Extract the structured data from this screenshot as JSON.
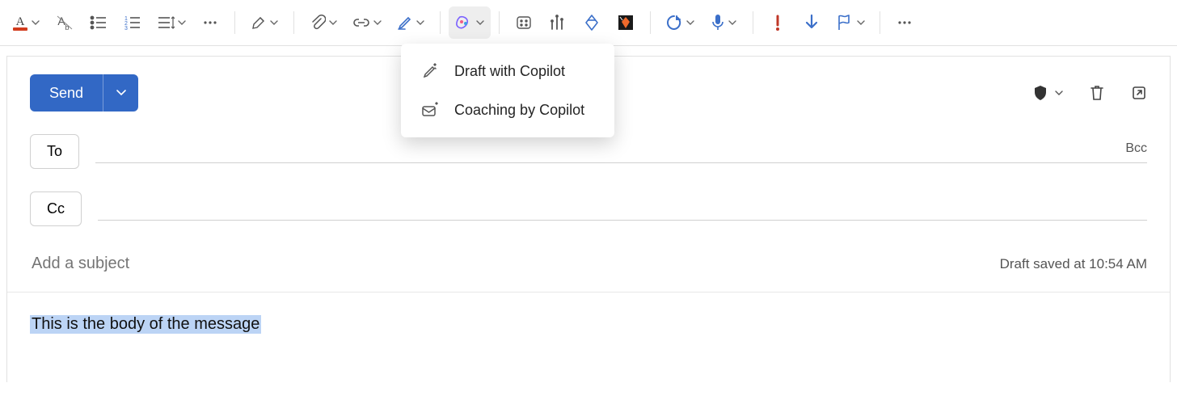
{
  "toolbar": {
    "icons": {
      "font_color": "font-color-icon",
      "clear_formatting": "clear-formatting-icon",
      "bullets": "bullets-icon",
      "numbering": "numbering-icon",
      "line_spacing": "line-spacing-icon",
      "more_format": "more-icon",
      "highlight": "highlight-pen-icon",
      "attach": "paperclip-icon",
      "link": "link-icon",
      "signature": "signature-icon",
      "copilot": "copilot-icon",
      "apps": "apps-grid-icon",
      "poll": "poll-bar-icon",
      "viva": "viva-diamond-icon",
      "addin": "addin-square-icon",
      "loop": "loop-icon",
      "dictate": "microphone-icon",
      "importance": "importance-icon",
      "download": "download-arrow-icon",
      "flag": "flag-outline-icon",
      "overflow": "more-icon"
    }
  },
  "copilot_menu": {
    "draft": "Draft with Copilot",
    "coaching": "Coaching by Copilot"
  },
  "compose": {
    "send_label": "Send",
    "to_label": "To",
    "cc_label": "Cc",
    "bcc_label": "Bcc",
    "subject_placeholder": "Add a subject",
    "draft_saved": "Draft saved at 10:54 AM",
    "body_text": "This is the body of the message"
  }
}
